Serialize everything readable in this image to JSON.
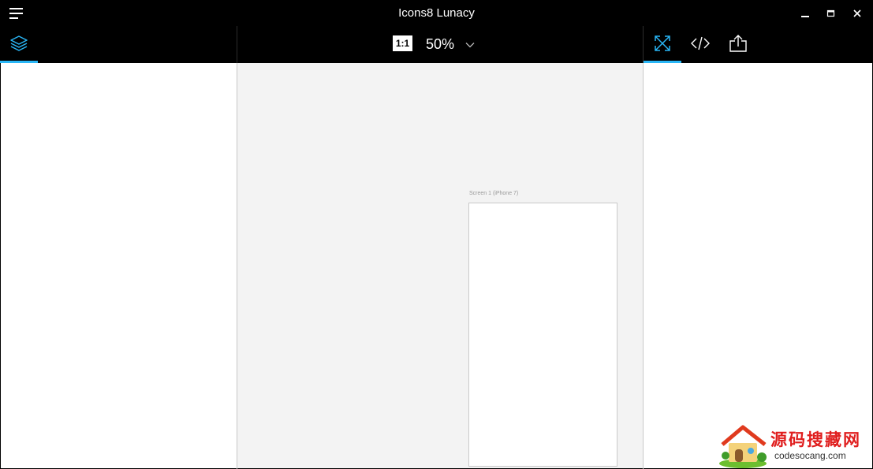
{
  "window": {
    "title": "Icons8 Lunacy",
    "controls": [
      "minimize-icon",
      "maximize-icon",
      "close-icon"
    ]
  },
  "toolbar": {
    "left_tabs": [
      {
        "name": "layers",
        "icon": "layers-icon",
        "active": true
      }
    ],
    "actual_size_label": "1:1",
    "zoom": "50%",
    "zoom_dropdown_icon": "chevron-down-icon",
    "right_tabs": [
      {
        "name": "inspect",
        "icon": "resize-arrows-icon",
        "active": true
      },
      {
        "name": "code",
        "icon": "code-icon",
        "active": false
      },
      {
        "name": "export",
        "icon": "share-export-icon",
        "active": false
      }
    ]
  },
  "canvas": {
    "artboard": {
      "label": "Screen 1 (iPhone 7)"
    }
  },
  "watermark": {
    "title": "源码搜藏网",
    "url": "codesocang.com"
  },
  "colors": {
    "accent": "#29b6f6",
    "titlebar_bg": "#000000",
    "canvas_bg": "#f3f3f3",
    "panel_bg": "#ffffff",
    "watermark_red": "#e01e1e"
  }
}
